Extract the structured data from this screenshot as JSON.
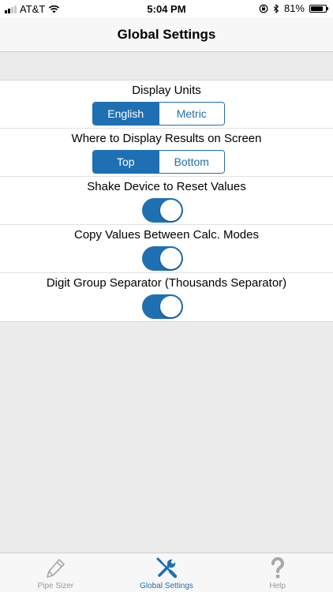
{
  "status_bar": {
    "carrier": "AT&T",
    "time": "5:04 PM",
    "battery_percent": "81%",
    "battery_level": 0.81
  },
  "nav": {
    "title": "Global Settings"
  },
  "settings": {
    "display_units": {
      "label": "Display Units",
      "options": [
        "English",
        "Metric"
      ],
      "selected": "English"
    },
    "results_position": {
      "label": "Where to Display Results on Screen",
      "options": [
        "Top",
        "Bottom"
      ],
      "selected": "Top"
    },
    "shake_reset": {
      "label": "Shake Device to Reset Values",
      "on": true
    },
    "copy_values": {
      "label": "Copy Values Between Calc. Modes",
      "on": true
    },
    "digit_separator": {
      "label": "Digit Group Separator (Thousands Separator)",
      "on": true
    }
  },
  "tab_bar": {
    "tabs": [
      {
        "label": "Pipe Sizer",
        "icon": "pencil-icon",
        "active": false
      },
      {
        "label": "Global Settings",
        "icon": "tools-icon",
        "active": true
      },
      {
        "label": "Help",
        "icon": "question-icon",
        "active": false
      }
    ]
  },
  "colors": {
    "accent": "#1f6fb3",
    "inactive": "#9a9a9a"
  }
}
